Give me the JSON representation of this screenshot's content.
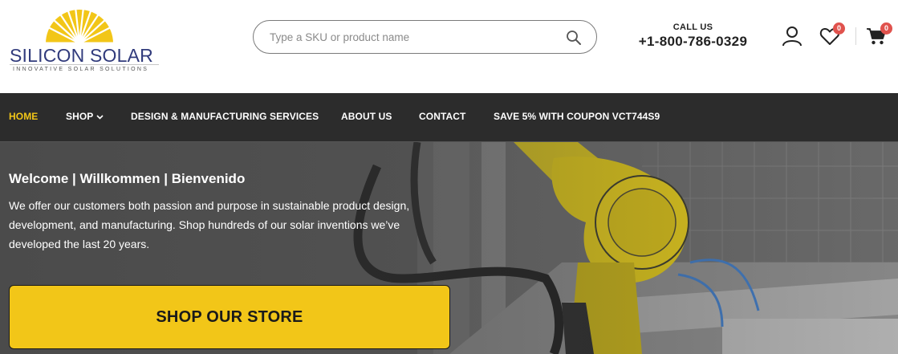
{
  "brand": {
    "name": "SILICON SOLAR",
    "tagline": "INNOVATIVE SOLAR SOLUTIONS",
    "color": "#313b7c",
    "sun_color": "#f2c618"
  },
  "search": {
    "placeholder": "Type a SKU or product name",
    "icon": "search-icon"
  },
  "contact": {
    "label": "CALL US",
    "phone": "+1-800-786-0329"
  },
  "header_icons": {
    "account_icon": "user-icon",
    "wishlist_icon": "heart-icon",
    "wishlist_count": "0",
    "cart_icon": "cart-icon",
    "cart_count": "0"
  },
  "nav": {
    "items": [
      {
        "label": "HOME",
        "active": true
      },
      {
        "label": "SHOP",
        "has_dropdown": true
      },
      {
        "label": "DESIGN & MANUFACTURING SERVICES"
      },
      {
        "label": "ABOUT US"
      },
      {
        "label": "CONTACT"
      },
      {
        "label": "SAVE 5% WITH COUPON VCT744S9"
      }
    ]
  },
  "hero": {
    "title": "Welcome | Willkommen | Bienvenido",
    "text": "We offer our customers both passion and purpose in sustainable product design, development, and manufacturing. Shop hundreds of our solar inventions we’ve developed the last 20 years.",
    "cta_label": "SHOP OUR STORE"
  },
  "colors": {
    "accent": "#f2c618",
    "nav_bg": "#2c2c2c",
    "badge": "#e0524d"
  }
}
